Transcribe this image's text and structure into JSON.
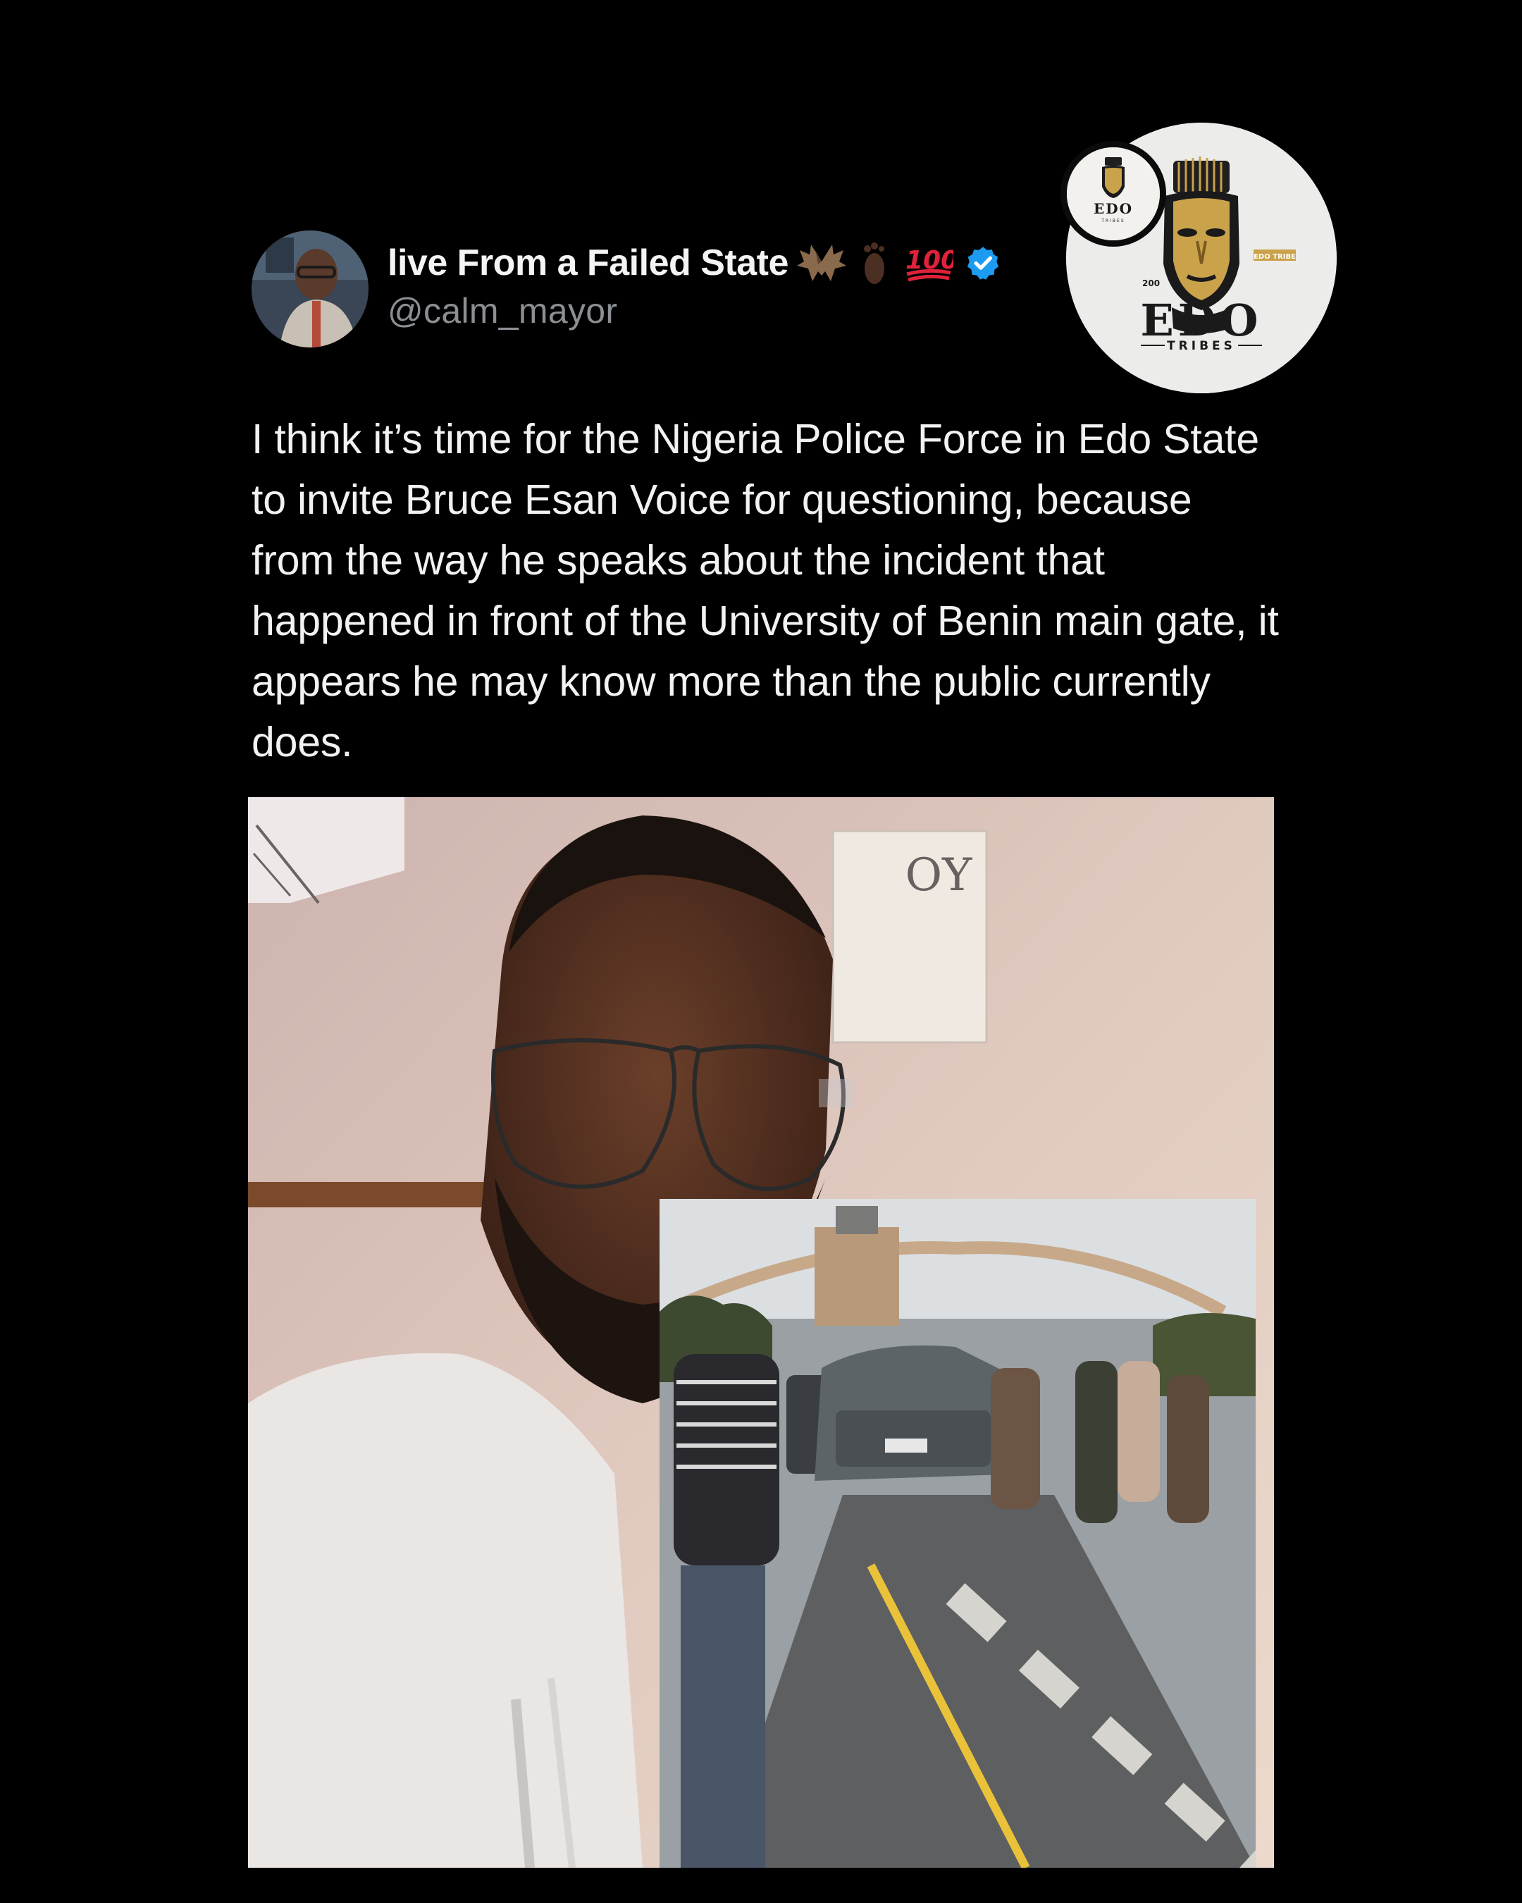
{
  "post": {
    "display_name": "live From a Failed State",
    "name_emojis": [
      "bat-emoji",
      "footprint-emoji",
      "hundred-points-emoji"
    ],
    "verified": true,
    "handle": "@calm_mayor",
    "text": "I think it’s time for the Nigeria Police Force in Edo State to invite Bruce Esan Voice for questioning, because from the way he speaks about the incident that happened in front of the University of Benin main gate, it appears he may know more than the public currently does."
  },
  "logo": {
    "brand": "EDO",
    "tagline": "TRIBES",
    "number": "200",
    "side_tag": "EDO TRIBE",
    "mini_brand": "EDO",
    "mini_tagline": "TRIBES"
  },
  "media": {
    "type": "video-screenshot",
    "poster_text": "OY"
  },
  "colors": {
    "background": "#000000",
    "text": "#f2f2f2",
    "handle": "#8b8f94",
    "verified": "#1d9bf0",
    "logo_gold": "#c9a24a"
  }
}
